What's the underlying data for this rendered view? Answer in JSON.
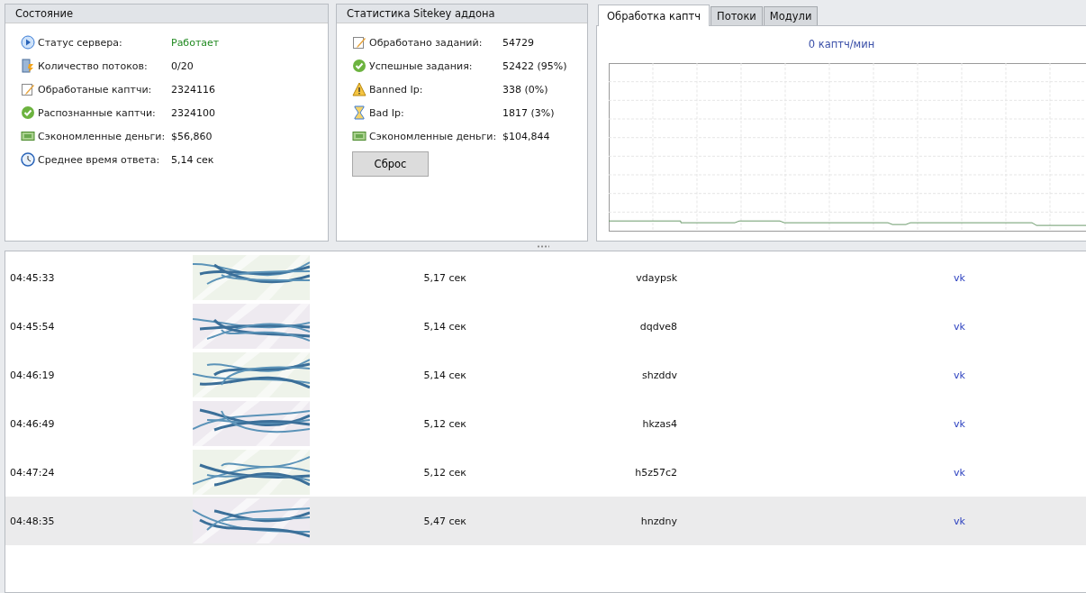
{
  "status_panel": {
    "title": "Состояние",
    "items": [
      {
        "kind": "play",
        "label": "Статус сервера:",
        "value": "Работает",
        "ok": true
      },
      {
        "kind": "threads",
        "label": "Количество потоков:",
        "value": "0/20",
        "ok": false
      },
      {
        "kind": "edit",
        "label": "Обработаные каптчи:",
        "value": "2324116",
        "ok": false
      },
      {
        "kind": "check",
        "label": "Распознанные каптчи:",
        "value": "2324100",
        "ok": false
      },
      {
        "kind": "money",
        "label": "Сэкономленные деньги:",
        "value": "$56,860",
        "ok": false
      },
      {
        "kind": "clock",
        "label": "Среднее время ответа:",
        "value": "5,14 сек",
        "ok": false
      }
    ]
  },
  "addon_panel": {
    "title": "Статистика Sitekey аддона",
    "items": [
      {
        "kind": "edit",
        "label": "Обработано заданий:",
        "value": "54729"
      },
      {
        "kind": "check",
        "label": "Успешные задания:",
        "value": "52422 (95%)"
      },
      {
        "kind": "warning",
        "label": "Banned Ip:",
        "value": "338 (0%)"
      },
      {
        "kind": "hourglass",
        "label": "Bad Ip:",
        "value": "1817 (3%)"
      },
      {
        "kind": "money",
        "label": "Сэкономленные деньги:",
        "value": "$104,844"
      }
    ],
    "button": "Сброс"
  },
  "tabs": [
    {
      "label": "Обработка каптч",
      "selected": true
    },
    {
      "label": "Потоки",
      "selected": false
    },
    {
      "label": "Модули",
      "selected": false
    }
  ],
  "rate": "0 каптч/мин",
  "rows": [
    {
      "time": "04:45:33",
      "duration": "5,17 сек",
      "answer": "vdaypsk",
      "module": "vk",
      "selected": false
    },
    {
      "time": "04:45:54",
      "duration": "5,14 сек",
      "answer": "dqdve8",
      "module": "vk",
      "selected": false
    },
    {
      "time": "04:46:19",
      "duration": "5,14 сек",
      "answer": "shzddv",
      "module": "vk",
      "selected": false
    },
    {
      "time": "04:46:49",
      "duration": "5,12 сек",
      "answer": "hkzas4",
      "module": "vk",
      "selected": false
    },
    {
      "time": "04:47:24",
      "duration": "5,12 сек",
      "answer": "h5z57c2",
      "module": "vk",
      "selected": false
    },
    {
      "time": "04:48:35",
      "duration": "5,47 сек",
      "answer": "hnzdny",
      "module": "vk",
      "selected": true
    }
  ]
}
